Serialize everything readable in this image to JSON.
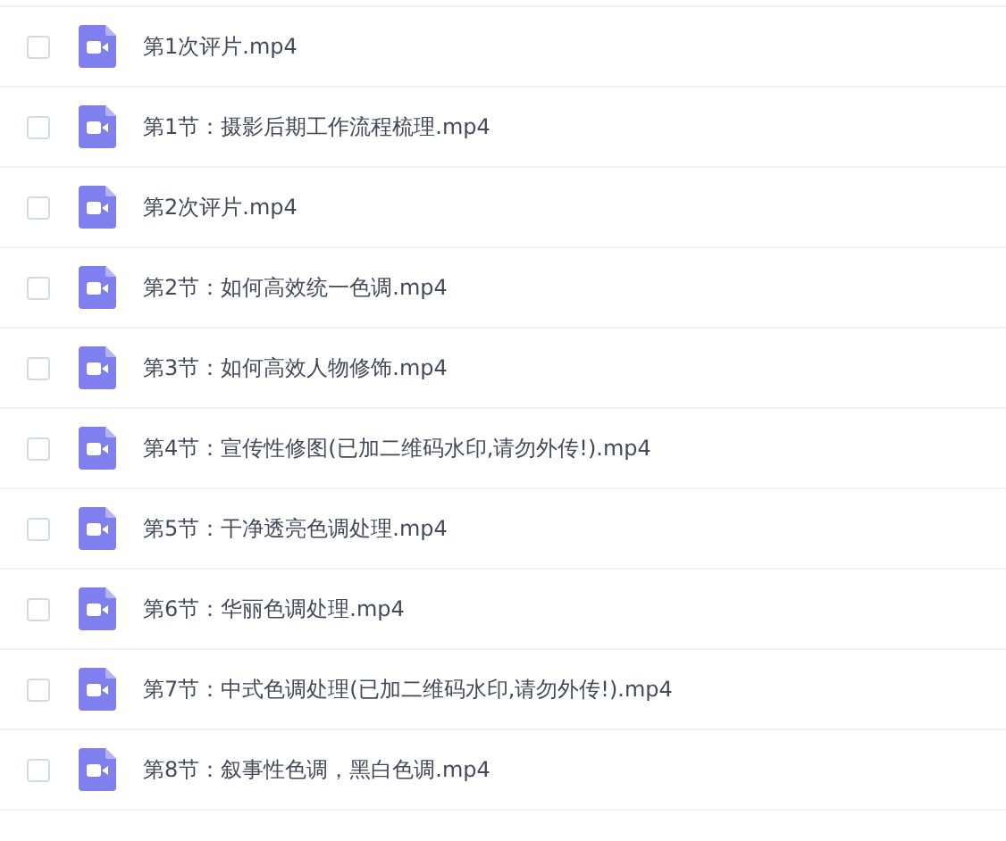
{
  "files": [
    {
      "name": "第1次评片.mp4",
      "checked": false
    },
    {
      "name": "第1节：摄影后期工作流程梳理.mp4",
      "checked": false
    },
    {
      "name": "第2次评片.mp4",
      "checked": false
    },
    {
      "name": "第2节：如何高效统一色调.mp4",
      "checked": false
    },
    {
      "name": "第3节：如何高效人物修饰.mp4",
      "checked": false
    },
    {
      "name": "第4节：宣传性修图(已加二维码水印,请勿外传!).mp4",
      "checked": false
    },
    {
      "name": "第5节：干净透亮色调处理.mp4",
      "checked": false
    },
    {
      "name": "第6节：华丽色调处理.mp4",
      "checked": false
    },
    {
      "name": "第7节：中式色调处理(已加二维码水印,请勿外传!).mp4",
      "checked": false
    },
    {
      "name": "第8节：叙事性色调，黑白色调.mp4",
      "checked": false
    }
  ]
}
